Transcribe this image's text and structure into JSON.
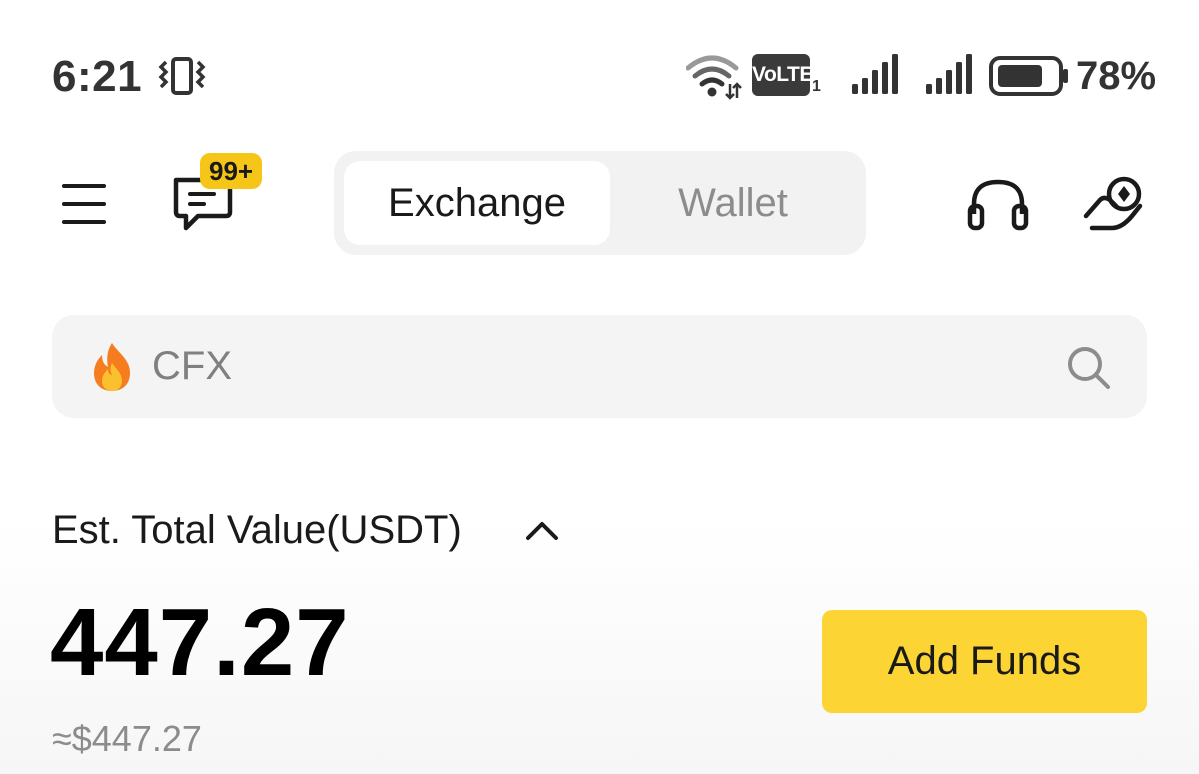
{
  "status_bar": {
    "time": "6:21",
    "volte_label": "VoLTE",
    "volte_sim": "1",
    "battery_percent": "78%",
    "battery_level": 0.78
  },
  "header": {
    "notification_badge": "99+",
    "tabs": [
      {
        "label": "Exchange",
        "active": true
      },
      {
        "label": "Wallet",
        "active": false
      }
    ],
    "icons": [
      "menu-icon",
      "message-icon",
      "headset-icon",
      "referral-hand-icon"
    ]
  },
  "search": {
    "placeholder": "CFX",
    "leading_icon": "fire-icon",
    "trailing_icon": "search-icon"
  },
  "balance": {
    "label": "Est. Total Value(USDT)",
    "value": "447.27",
    "approx": "≈$447.27",
    "add_funds_label": "Add Funds"
  },
  "colors": {
    "accent_yellow": "#fcd535",
    "badge_yellow": "#f5c518",
    "text_primary": "#1a1a1a",
    "text_muted": "#8c8c8c",
    "surface_gray": "#f4f4f4"
  }
}
